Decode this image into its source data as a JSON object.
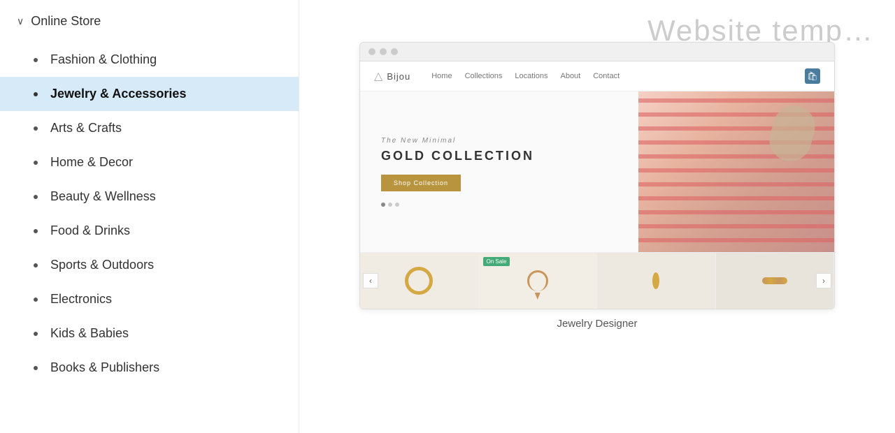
{
  "sidebar": {
    "header": {
      "label": "Online Store",
      "chevron": "∨"
    },
    "items": [
      {
        "id": "fashion",
        "label": "Fashion & Clothing",
        "active": false
      },
      {
        "id": "jewelry",
        "label": "Jewelry & Accessories",
        "active": true
      },
      {
        "id": "arts",
        "label": "Arts & Crafts",
        "active": false
      },
      {
        "id": "home",
        "label": "Home & Decor",
        "active": false
      },
      {
        "id": "beauty",
        "label": "Beauty & Wellness",
        "active": false
      },
      {
        "id": "food",
        "label": "Food & Drinks",
        "active": false
      },
      {
        "id": "sports",
        "label": "Sports & Outdoors",
        "active": false
      },
      {
        "id": "electronics",
        "label": "Electronics",
        "active": false
      },
      {
        "id": "kids",
        "label": "Kids & Babies",
        "active": false
      },
      {
        "id": "books",
        "label": "Books & Publishers",
        "active": false
      }
    ]
  },
  "main": {
    "page_title": "Website temp…",
    "preview": {
      "nav": {
        "logo": "Bijou",
        "logo_icon": "△",
        "links": [
          "Home",
          "Collections",
          "Locations",
          "About",
          "Contact"
        ]
      },
      "hero": {
        "subtitle": "The New Minimal",
        "title": "GOLD COLLECTION",
        "button_label": "Shop Collection"
      },
      "products": [
        {
          "id": 1,
          "type": "ring",
          "on_sale": false
        },
        {
          "id": 2,
          "type": "necklace",
          "on_sale": true
        },
        {
          "id": 3,
          "type": "earring",
          "on_sale": false
        },
        {
          "id": 4,
          "type": "chain",
          "on_sale": false
        }
      ],
      "label": "Jewelry Designer"
    }
  },
  "colors": {
    "sidebar_active_bg": "#d6eaf8",
    "hero_btn": "#b8943f",
    "on_sale": "#44aa77"
  }
}
